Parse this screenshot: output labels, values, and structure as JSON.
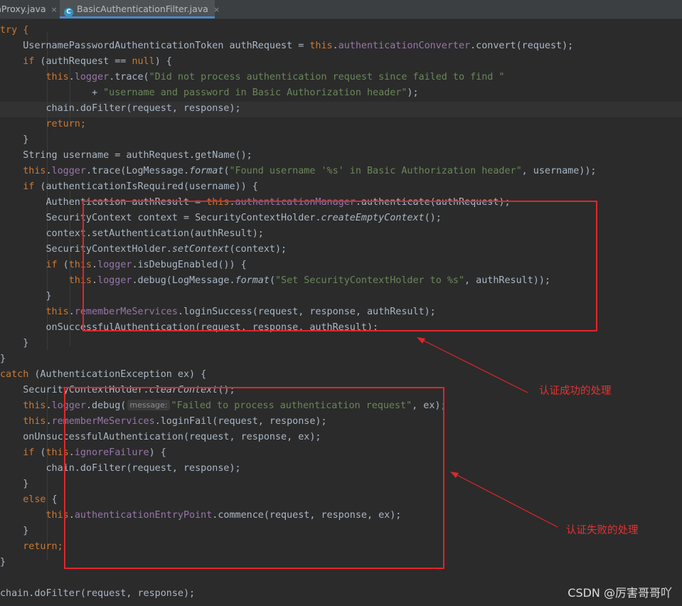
{
  "tabs": [
    {
      "label": "nProxy.java",
      "close": "×"
    },
    {
      "label": "BasicAuthenticationFilter.java",
      "close": "×",
      "icon": "C"
    }
  ],
  "annotations": {
    "success": "认证成功的处理",
    "failure": "认证失败的处理"
  },
  "hint": {
    "message": "message:"
  },
  "watermark": "CSDN @厉害哥哥吖",
  "colors": {
    "keyword": "#cc7832",
    "field": "#9876aa",
    "string": "#6a8759",
    "default": "#a9b7c6",
    "annotation": "#e0262b"
  },
  "code": {
    "l01": "try {",
    "l02a": "    UsernamePasswordAuthenticationToken authRequest = ",
    "l02b": "this",
    "l02c": ".",
    "l02d": "authenticationConverter",
    "l02e": ".convert(request);",
    "l03a": "    ",
    "l03b": "if",
    "l03c": " (authRequest == ",
    "l03d": "null",
    "l03e": ") {",
    "l04a": "        ",
    "l04b": "this",
    "l04c": ".",
    "l04d": "logger",
    "l04e": ".trace(",
    "l04f": "\"Did not process authentication request since failed to find \"",
    "l05a": "                + ",
    "l05b": "\"username and password in Basic Authorization header\"",
    "l05c": ");",
    "l06": "        chain.doFilter(request, response);",
    "l07a": "        ",
    "l07b": "return",
    "l07c": ";",
    "l08": "    }",
    "l09": "    String username = authRequest.getName();",
    "l10a": "    ",
    "l10b": "this",
    "l10c": ".",
    "l10d": "logger",
    "l10e": ".trace(LogMessage.",
    "l10f": "format",
    "l10g": "(",
    "l10h": "\"Found username '%s' in Basic Authorization header\"",
    "l10i": ", username));",
    "l11a": "    ",
    "l11b": "if",
    "l11c": " (authenticationIsRequired(username)) {",
    "l12a": "        Authentication authResult = ",
    "l12b": "this",
    "l12c": ".",
    "l12d": "authenticationManager",
    "l12e": ".authenticate(authRequest);",
    "l13a": "        SecurityContext context = SecurityContextHolder.",
    "l13b": "createEmptyContext",
    "l13c": "();",
    "l14": "        context.setAuthentication(authResult);",
    "l15a": "        SecurityContextHolder.",
    "l15b": "setContext",
    "l15c": "(context);",
    "l16a": "        ",
    "l16b": "if",
    "l16c": " (",
    "l16d": "this",
    "l16e": ".",
    "l16f": "logger",
    "l16g": ".isDebugEnabled()) {",
    "l17a": "            ",
    "l17b": "this",
    "l17c": ".",
    "l17d": "logger",
    "l17e": ".debug(LogMessage.",
    "l17f": "format",
    "l17g": "(",
    "l17h": "\"Set SecurityContextHolder to %s\"",
    "l17i": ", authResult));",
    "l18": "        }",
    "l19a": "        ",
    "l19b": "this",
    "l19c": ".",
    "l19d": "rememberMeServices",
    "l19e": ".loginSuccess(request, response, authResult);",
    "l20": "        onSuccessfulAuthentication(request, response, authResult);",
    "l21": "    }",
    "l22": "}",
    "l23a": "catch",
    "l23b": " (AuthenticationException ex) {",
    "l24a": "    SecurityContextHolder.",
    "l24b": "clearContext",
    "l24c": "();",
    "l25a": "    ",
    "l25b": "this",
    "l25c": ".",
    "l25d": "logger",
    "l25e": ".debug(",
    "l25f": "\"Failed to process authentication request\"",
    "l25g": ", ex);",
    "l26a": "    ",
    "l26b": "this",
    "l26c": ".",
    "l26d": "rememberMeServices",
    "l26e": ".loginFail(request, response);",
    "l27": "    onUnsuccessfulAuthentication(request, response, ex);",
    "l28a": "    ",
    "l28b": "if",
    "l28c": " (",
    "l28d": "this",
    "l28e": ".",
    "l28f": "ignoreFailure",
    "l28g": ") {",
    "l29": "        chain.doFilter(request, response);",
    "l30": "    }",
    "l31a": "    ",
    "l31b": "else",
    "l31c": " {",
    "l32a": "        ",
    "l32b": "this",
    "l32c": ".",
    "l32d": "authenticationEntryPoint",
    "l32e": ".commence(request, response, ex);",
    "l33": "    }",
    "l34a": "    ",
    "l34b": "return",
    "l34c": ";",
    "l35": "}",
    "l36": "",
    "l37": "chain.doFilter(request, response);"
  }
}
